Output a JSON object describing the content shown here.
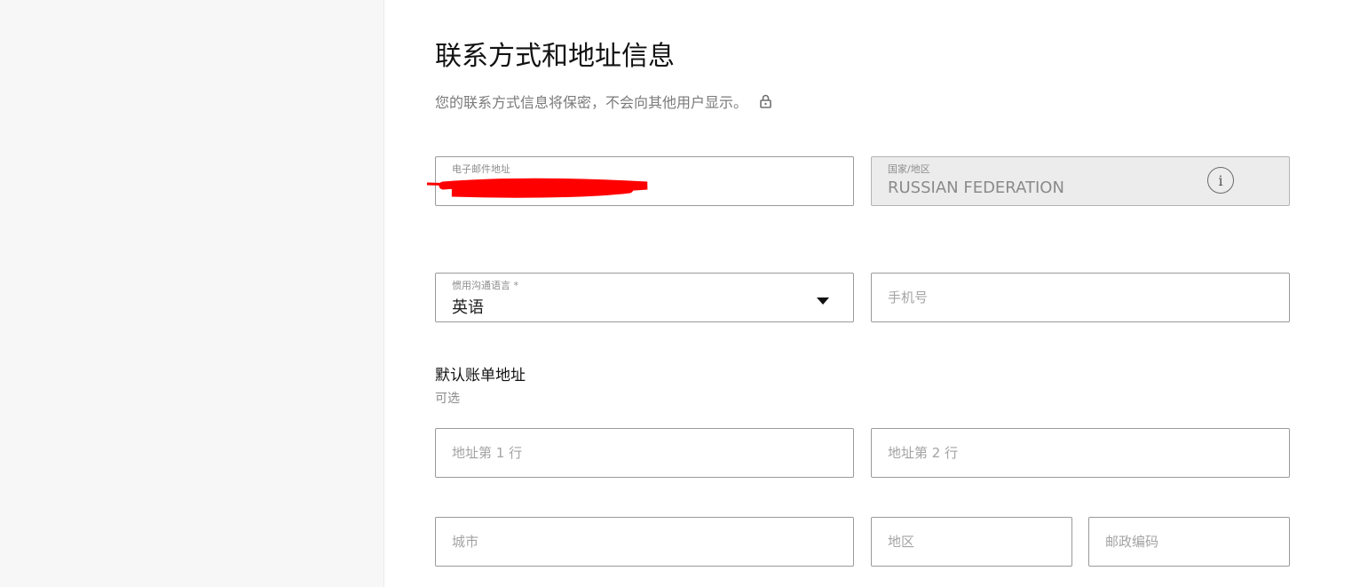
{
  "form": {
    "title": "联系方式和地址信息",
    "subtitle": "您的联系方式信息将保密，不会向其他用户显示。",
    "email": {
      "label": "电子邮件地址",
      "value": ""
    },
    "country": {
      "label": "国家/地区",
      "value": "RUSSIAN FEDERATION",
      "info_icon": "i"
    },
    "language": {
      "label": "惯用沟通语言 *",
      "value": "英语"
    },
    "phone": {
      "placeholder": "手机号"
    },
    "billing": {
      "title": "默认账单地址",
      "optional": "可选",
      "address_line1": "地址第 1 行",
      "address_line2": "地址第 2 行",
      "city": "城市",
      "region": "地区",
      "postal_code": "邮政编码"
    }
  },
  "icons": {
    "lock": "lock-icon",
    "info": "info-icon",
    "dropdown": "chevron-down-icon"
  },
  "colors": {
    "sidebar_bg": "#f7f7f7",
    "disabled_field_bg": "#ececec",
    "redaction": "#ff0000"
  }
}
